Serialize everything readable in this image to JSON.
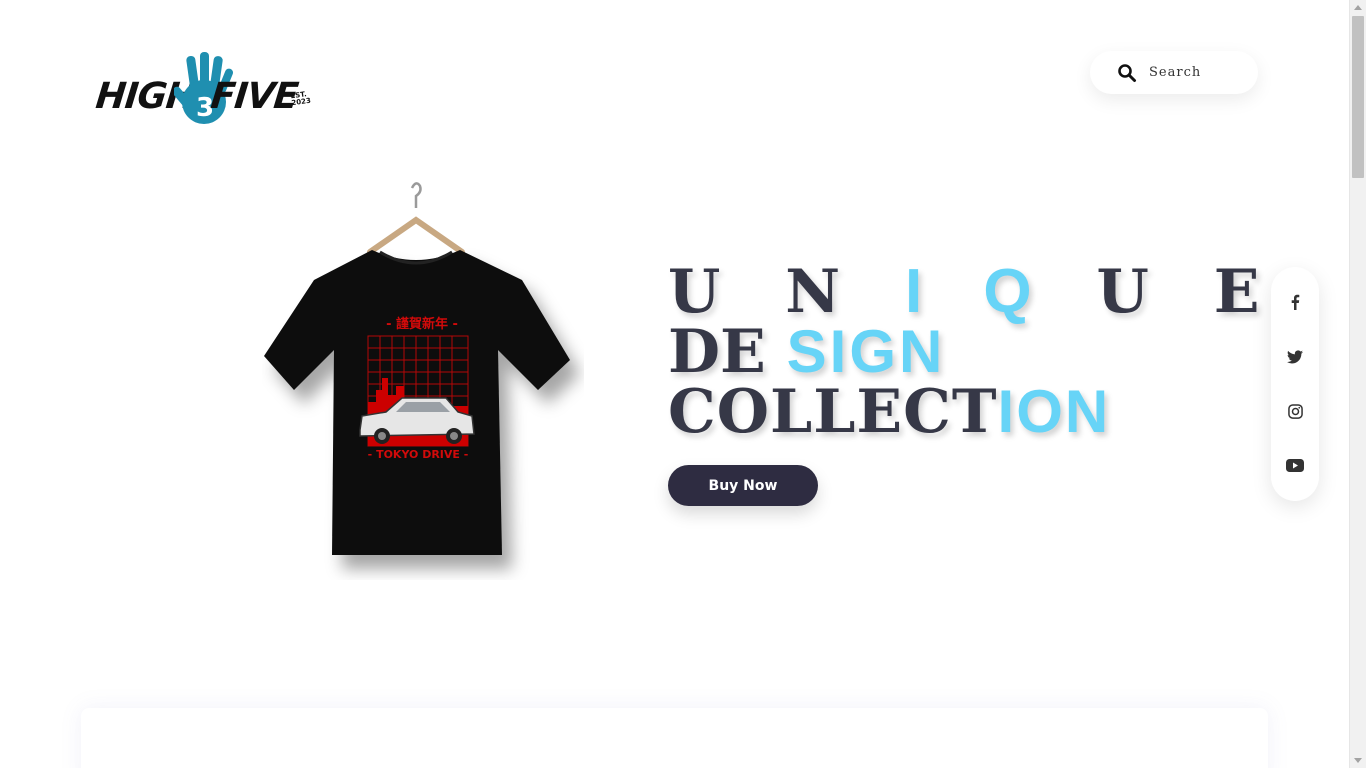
{
  "header": {
    "logo": {
      "left_text": "HIGH",
      "right_text": "FIVE",
      "est_line1": "EST.",
      "est_line2": "2023",
      "hand_color": "#1f8fb0"
    },
    "search": {
      "placeholder": "Search",
      "icon": "search-icon"
    }
  },
  "hero": {
    "line1": {
      "a": "U N ",
      "b": "I Q",
      "c": " U E"
    },
    "line2": {
      "a": "DE ",
      "b": "SIGN"
    },
    "line3": {
      "a": "COLLECT",
      "b": "ION"
    },
    "buy_button": "Buy Now",
    "accent_color": "#67d4f7",
    "dark_color": "#363847"
  },
  "product": {
    "print_top": "- 謹賀新年 -",
    "print_bottom": "- TOKYO DRIVE -",
    "shirt_color": "#0b0b0b",
    "print_color": "#d10a0a"
  },
  "social": {
    "items": [
      {
        "name": "facebook",
        "icon": "facebook-icon",
        "glyph": "f"
      },
      {
        "name": "twitter",
        "icon": "twitter-icon"
      },
      {
        "name": "instagram",
        "icon": "instagram-icon"
      },
      {
        "name": "youtube",
        "icon": "youtube-icon"
      }
    ]
  }
}
